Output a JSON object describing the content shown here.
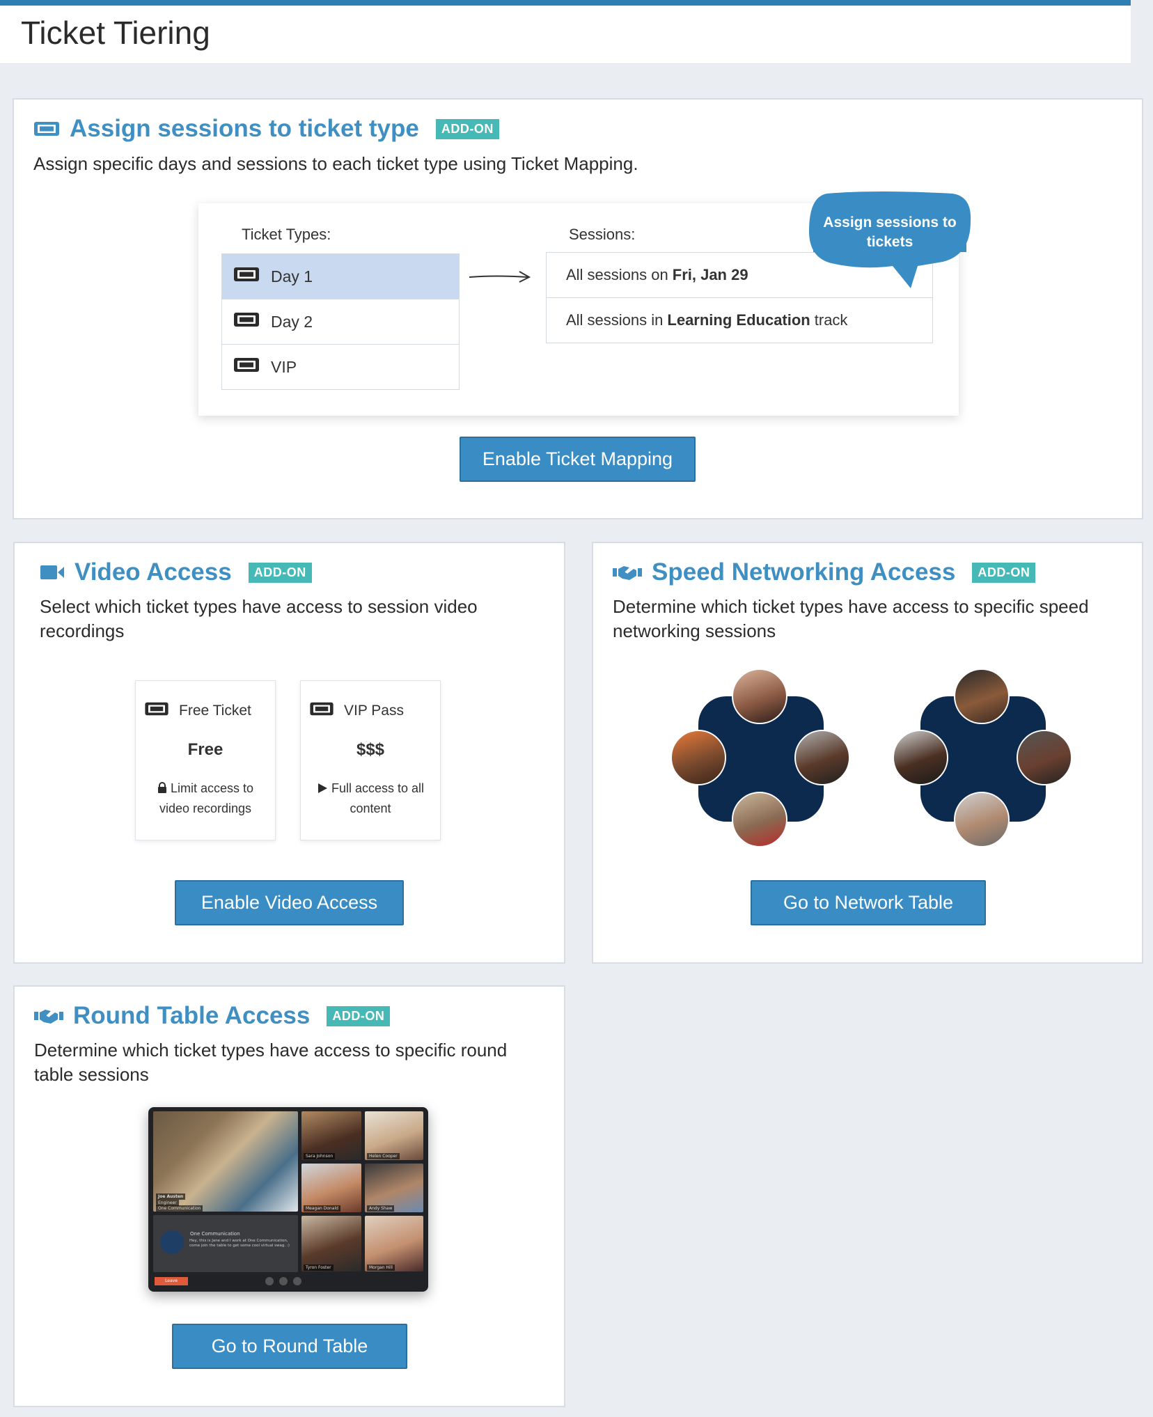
{
  "page": {
    "title": "Ticket Tiering"
  },
  "colors": {
    "accent": "#3f8fc2",
    "button": "#3a8dc4",
    "badge": "#46b8b6",
    "selected_row": "#c9daf0",
    "blob": "#0b2a4d"
  },
  "badge_label": "ADD-ON",
  "ticket_mapping": {
    "title": "Assign sessions to ticket type",
    "icon": "ticket-icon",
    "description": "Assign specific days and sessions to each ticket type using Ticket Mapping.",
    "ticket_types_label": "Ticket Types:",
    "sessions_label": "Sessions:",
    "ticket_types": [
      {
        "label": "Day 1",
        "selected": true
      },
      {
        "label": "Day 2",
        "selected": false
      },
      {
        "label": "VIP",
        "selected": false
      }
    ],
    "sessions": [
      {
        "prefix": "All sessions on",
        "bold": "Fri, Jan 29",
        "suffix": ""
      },
      {
        "prefix": "All sessions in",
        "bold": "Learning Education",
        "suffix": "track"
      }
    ],
    "bubble_line1": "Assign sessions to",
    "bubble_line2": "tickets",
    "button": "Enable Ticket Mapping"
  },
  "video_access": {
    "title": "Video Access",
    "icon": "video-camera-icon",
    "description_line1": "Select which ticket types have access to session video",
    "description_line2": "recordings",
    "cards": [
      {
        "name": "Free Ticket",
        "price": "Free",
        "note_line1": "Limit access to",
        "note_line2": "video recordings",
        "note_icon": "lock-icon"
      },
      {
        "name": "VIP Pass",
        "price": "$$$",
        "note_line1": "Full access to all",
        "note_line2": "content",
        "note_icon": "play-icon"
      }
    ],
    "button": "Enable Video Access"
  },
  "speed_networking": {
    "title": "Speed Networking Access",
    "icon": "handshake-icon",
    "description_line1": "Determine which ticket types have access to specific speed",
    "description_line2": "networking sessions",
    "button": "Go to Network Table"
  },
  "round_table": {
    "title": "Round Table Access",
    "icon": "handshake-icon",
    "description_line1": "Determine which ticket types have access to specific round",
    "description_line2": "table sessions",
    "mock": {
      "host_name": "Joe Austen",
      "host_role": "Engineer",
      "host_company": "One Communication",
      "chat_title": "One Communication",
      "chat_text": "Hey, this is Jane and I work at One Communication, come join the table to get some cool virtual swag. :)",
      "leave": "Leave",
      "participants": [
        "Sara Johnson",
        "Helen Cooper",
        "Meagan Donald",
        "Andy Shaw",
        "Tyron Foster",
        "Morgan Hill"
      ]
    },
    "button": "Go to Round Table"
  }
}
